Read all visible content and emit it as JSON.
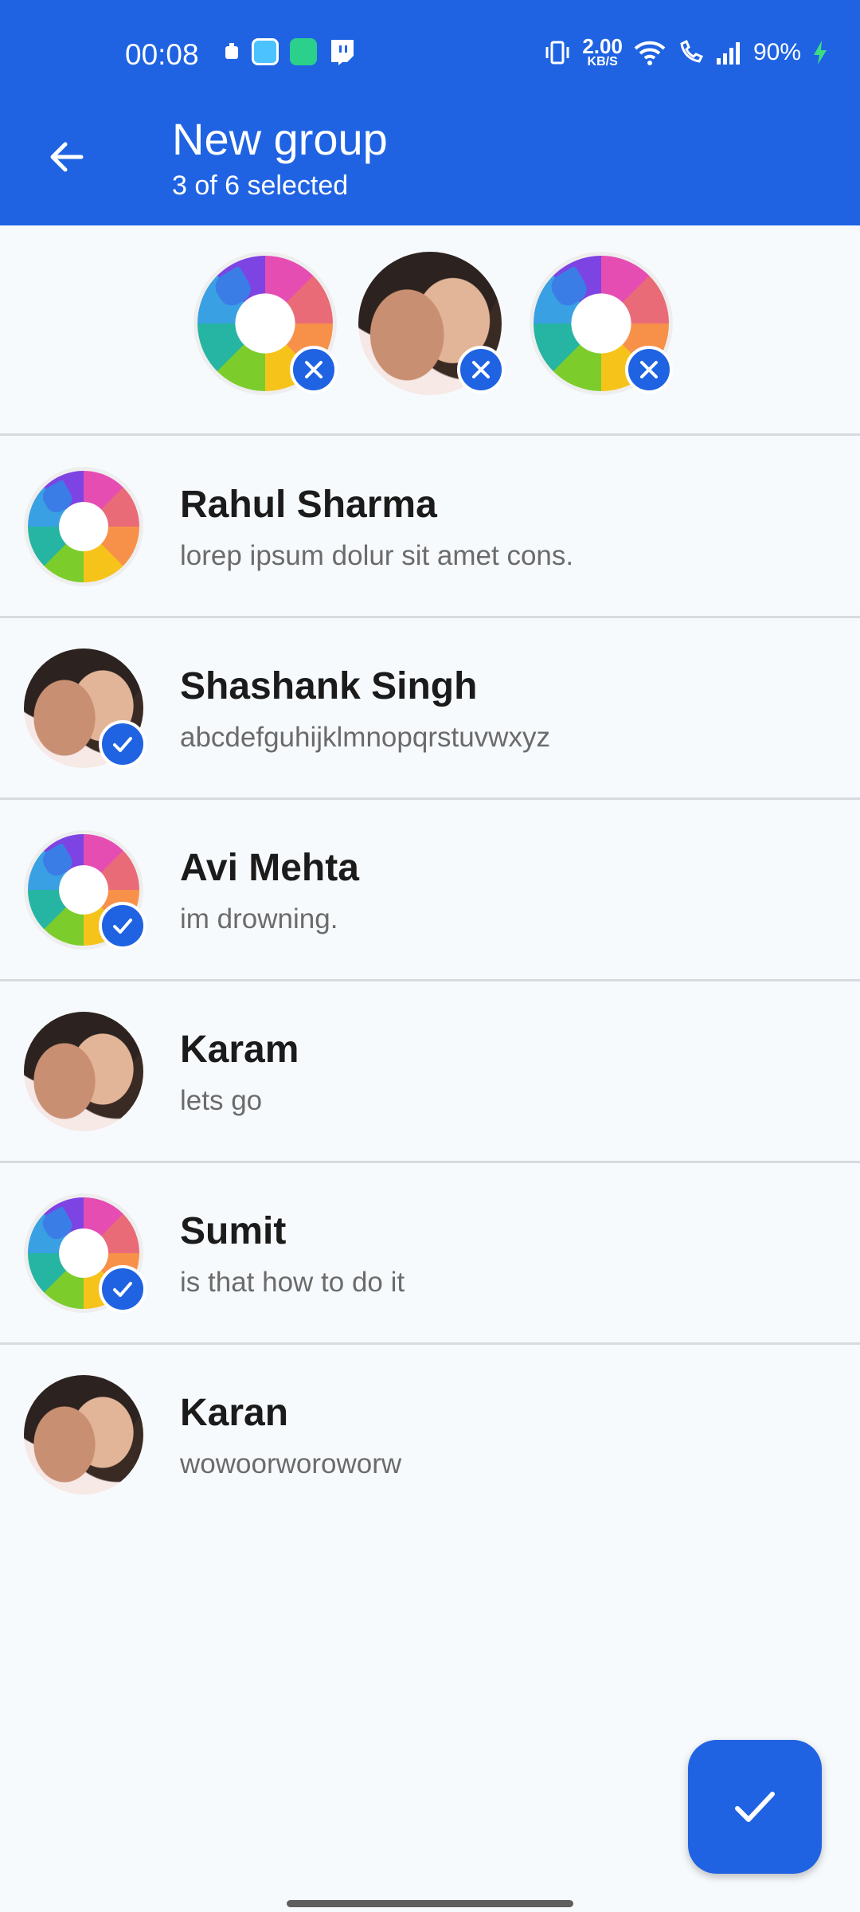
{
  "status_bar": {
    "time": "00:08",
    "speed": "2.00",
    "speed_unit": "KB/S",
    "battery": "90%"
  },
  "app_bar": {
    "title": "New group",
    "subtitle": "3 of 6 selected"
  },
  "selected": [
    {
      "avatar": "color-wheel-avatar"
    },
    {
      "avatar": "photo-avatar"
    },
    {
      "avatar": "color-wheel-avatar"
    }
  ],
  "contacts": [
    {
      "name": "Rahul Sharma",
      "message": "lorep ipsum dolur sit amet cons.",
      "avatar": "color-wheel-avatar",
      "selected": false
    },
    {
      "name": "Shashank Singh",
      "message": "abcdefguhijklmnopqrstuvwxyz",
      "avatar": "photo-avatar",
      "selected": true
    },
    {
      "name": "Avi Mehta",
      "message": "im drowning.",
      "avatar": "color-wheel-avatar",
      "selected": true
    },
    {
      "name": "Karam",
      "message": "lets go",
      "avatar": "photo-avatar",
      "selected": false
    },
    {
      "name": "Sumit",
      "message": "is that how to do it",
      "avatar": "color-wheel-avatar",
      "selected": true
    },
    {
      "name": "Karan",
      "message": "wowoorworoworw",
      "avatar": "photo-avatar",
      "selected": false
    }
  ],
  "colors": {
    "primary": "#1f63e3",
    "background": "#f7fafd"
  },
  "icons": {
    "back": "arrow-left-icon",
    "confirm": "check-icon",
    "remove": "close-icon",
    "selected": "check-icon"
  }
}
